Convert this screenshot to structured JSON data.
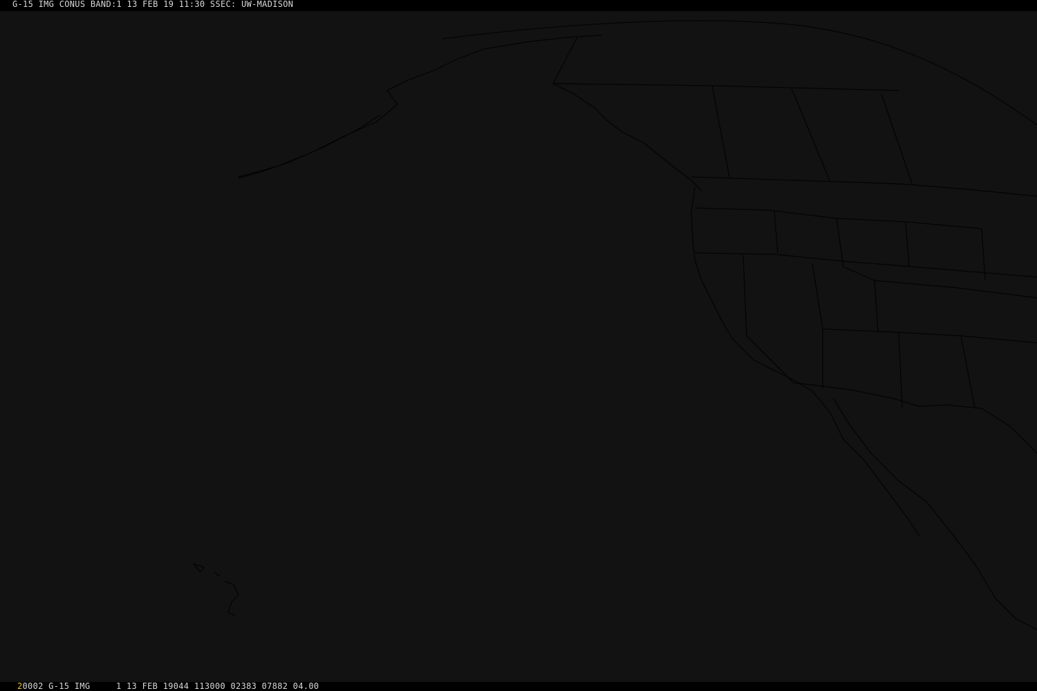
{
  "header": {
    "title": "G-15 IMG CONUS BAND:1 13 FEB 19 11:30 SSEC: UW-MADISON"
  },
  "footer": {
    "frame_number": "2",
    "info": "0002 G-15 IMG     1 13 FEB 19044 113000 02383 07882 04.00"
  },
  "colors": {
    "background": "#000000",
    "image_fill": "#121212",
    "map_lines": "#030303",
    "text": "#d9d9d9",
    "frame_number": "#e6c229"
  }
}
